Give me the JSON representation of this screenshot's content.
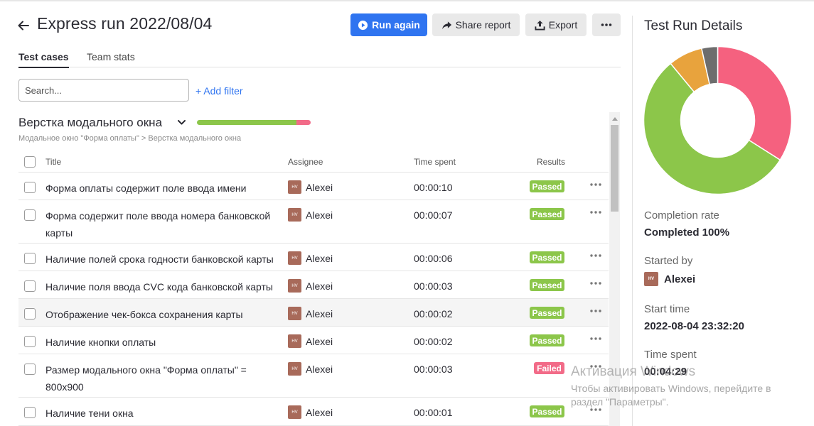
{
  "header": {
    "title": "Express run 2022/08/04",
    "run_again": "Run again",
    "share_report": "Share report",
    "export": "Export"
  },
  "tabs": [
    {
      "label": "Test cases",
      "active": true
    },
    {
      "label": "Team stats",
      "active": false
    }
  ],
  "search": {
    "placeholder": "Search...",
    "value": ""
  },
  "add_filter": "+ Add filter",
  "section": {
    "title": "Верстка модального окна",
    "breadcrumb": "Модальное окно \"Форма оплаты\" > Верстка модального окна",
    "progress": {
      "passed": 0.875,
      "failed": 0.125
    }
  },
  "table": {
    "columns": [
      "Title",
      "Assignee",
      "Time spent",
      "Results"
    ],
    "rows": [
      {
        "title": "Форма оплаты содержит поле ввода имени",
        "avatar": "HV",
        "assignee": "Alexei",
        "time": "00:00:10",
        "result": "Passed"
      },
      {
        "title": "Форма содержит поле ввода номера банковской карты",
        "avatar": "HV",
        "assignee": "Alexei",
        "time": "00:00:07",
        "result": "Passed"
      },
      {
        "title": "Наличие полей срока годности банковской карты",
        "avatar": "HV",
        "assignee": "Alexei",
        "time": "00:00:06",
        "result": "Passed"
      },
      {
        "title": "Наличие поля ввода CVC кода банковской карты",
        "avatar": "HV",
        "assignee": "Alexei",
        "time": "00:00:03",
        "result": "Passed"
      },
      {
        "title": "Отображение чек-бокса сохранения карты",
        "avatar": "HV",
        "assignee": "Alexei",
        "time": "00:00:02",
        "result": "Passed"
      },
      {
        "title": "Наличие кнопки оплаты",
        "avatar": "HV",
        "assignee": "Alexei",
        "time": "00:00:02",
        "result": "Passed"
      },
      {
        "title": "Размер модального окна \"Форма оплаты\" = 800x900",
        "avatar": "HV",
        "assignee": "Alexei",
        "time": "00:00:03",
        "result": "Failed"
      },
      {
        "title": "Наличие тени окна",
        "avatar": "HV",
        "assignee": "Alexei",
        "time": "00:00:01",
        "result": "Passed"
      }
    ]
  },
  "details": {
    "title": "Test Run Details",
    "completion_label": "Completion rate",
    "completion_value": "Completed 100%",
    "started_by_label": "Started by",
    "started_by_avatar": "HV",
    "started_by": "Alexei",
    "start_time_label": "Start time",
    "start_time": "2022-08-04 23:32:20",
    "time_spent_label": "Time spent",
    "time_spent": "00:04:29",
    "donut": [
      {
        "status": "failed",
        "fraction": 0.34,
        "color": "#f5617f"
      },
      {
        "status": "passed",
        "fraction": 0.55,
        "color": "#8cc64a"
      },
      {
        "status": "orange",
        "fraction": 0.075,
        "color": "#e8a33d"
      },
      {
        "status": "grey",
        "fraction": 0.035,
        "color": "#6d6d6d"
      }
    ]
  },
  "colors": {
    "primary": "#2f74f0",
    "passed": "#8cc64a",
    "failed": "#f26b88"
  },
  "watermark": {
    "title": "Активация Windows",
    "text": "Чтобы активировать Windows, перейдите в раздел \"Параметры\"."
  }
}
